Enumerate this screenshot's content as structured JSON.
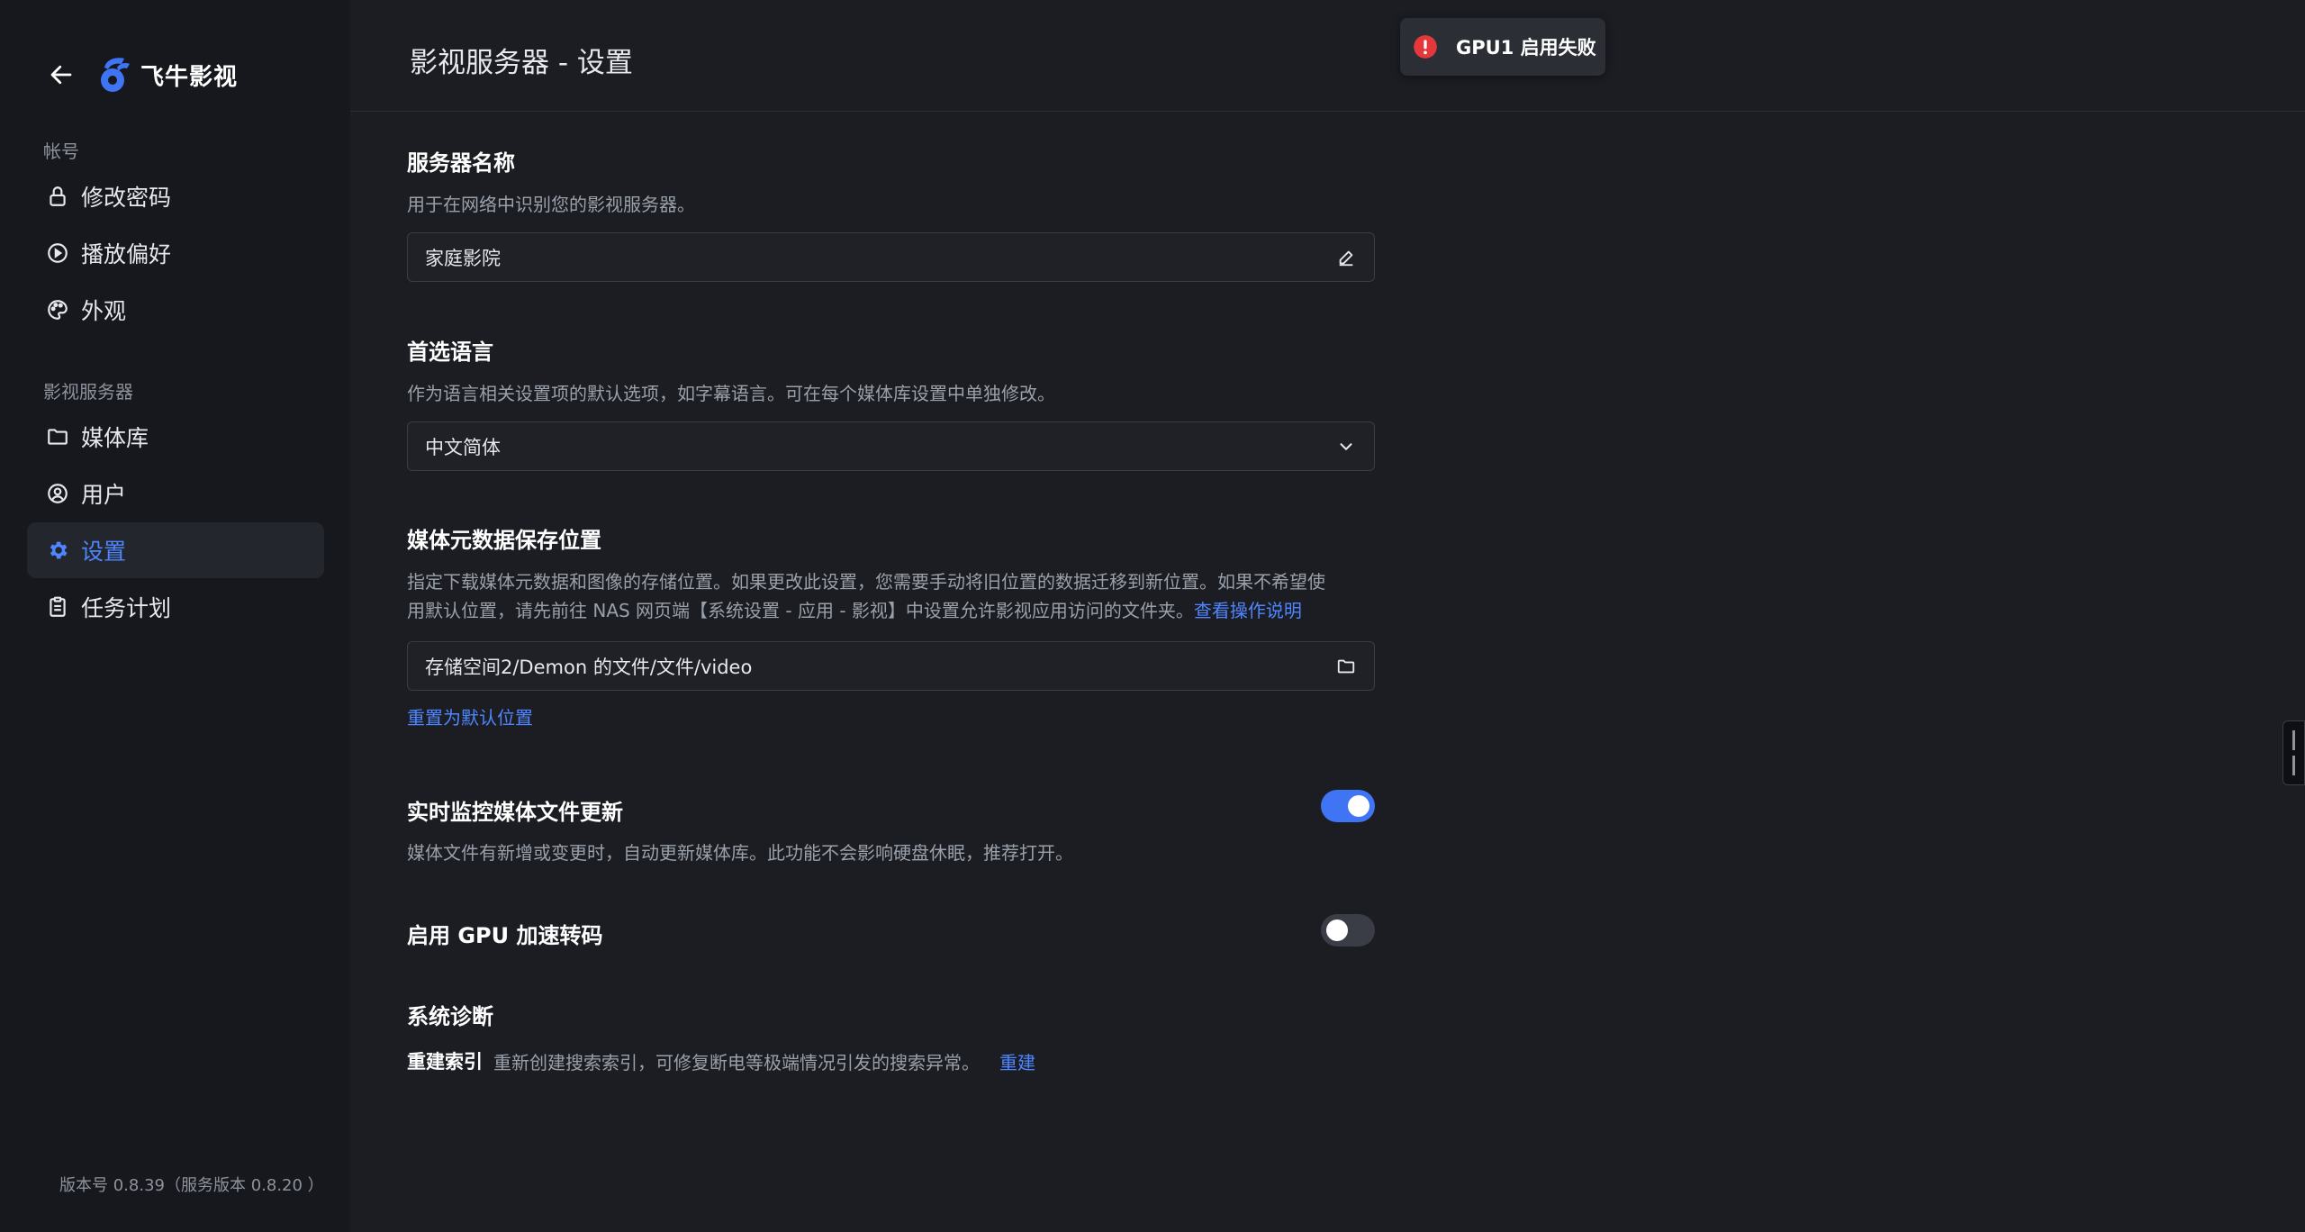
{
  "brand": {
    "name": "飞牛影视"
  },
  "sidebar": {
    "account_label": "帐号",
    "server_label": "影视服务器",
    "account_items": [
      {
        "label": "修改密码",
        "icon": "lock-icon"
      },
      {
        "label": "播放偏好",
        "icon": "play-circle-icon"
      },
      {
        "label": "外观",
        "icon": "palette-icon"
      }
    ],
    "server_items": [
      {
        "label": "媒体库",
        "icon": "folder-icon"
      },
      {
        "label": "用户",
        "icon": "user-icon"
      },
      {
        "label": "设置",
        "icon": "gear-icon",
        "active": true
      },
      {
        "label": "任务计划",
        "icon": "clipboard-icon"
      }
    ],
    "version": "版本号 0.8.39（服务版本 0.8.20 ）"
  },
  "header": {
    "title": "影视服务器 - 设置"
  },
  "toast": {
    "text": "GPU1 启用失败",
    "icon": "error-icon",
    "color": "#e5383b"
  },
  "settings": {
    "server_name": {
      "title": "服务器名称",
      "desc": "用于在网络中识别您的影视服务器。",
      "value": "家庭影院"
    },
    "language": {
      "title": "首选语言",
      "desc": "作为语言相关设置项的默认选项，如字幕语言。可在每个媒体库设置中单独修改。",
      "value": "中文简体"
    },
    "metadata": {
      "title": "媒体元数据保存位置",
      "desc_line1": "指定下载媒体元数据和图像的存储位置。如果更改此设置，您需要手动将旧位置的数据迁移到新位置。如果不希望使",
      "desc_line2": "用默认位置，请先前往 NAS 网页端【系统设置 - 应用 - 影视】中设置允许影视应用访问的文件夹。",
      "help_link": "查看操作说明",
      "path": "存储空间2/Demon 的文件/文件/video",
      "reset_link": "重置为默认位置"
    },
    "realtime": {
      "title": "实时监控媒体文件更新",
      "desc": "媒体文件有新增或变更时，自动更新媒体库。此功能不会影响硬盘休眠，推荐打开。",
      "enabled": true
    },
    "gpu": {
      "title": "启用 GPU 加速转码",
      "enabled": false
    },
    "diagnostics": {
      "title": "系统诊断",
      "rebuild_label": "重建索引",
      "rebuild_desc": "重新创建搜索索引，可修复断电等极端情况引发的搜索异常。",
      "rebuild_action": "重建"
    }
  },
  "colors": {
    "accent": "#4f86ff",
    "toggle_on": "#3f74f5",
    "background": "#1b1d23",
    "sidebar": "#16181d"
  }
}
